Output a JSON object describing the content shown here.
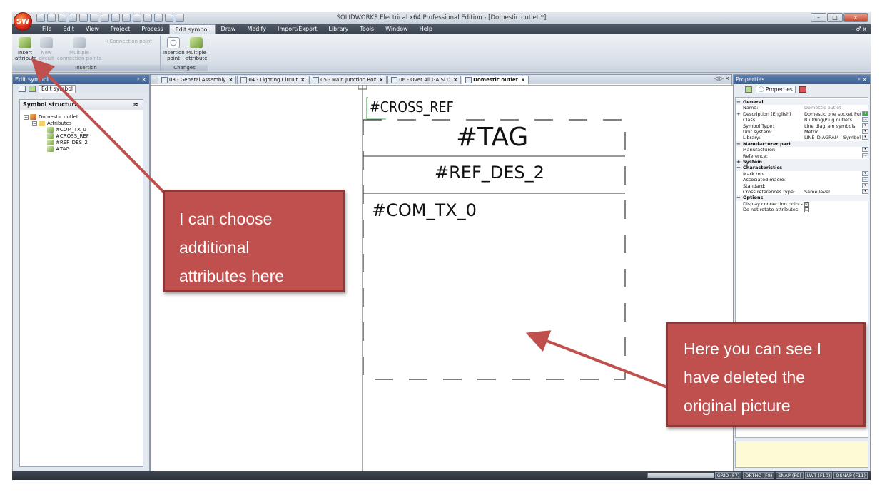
{
  "app": {
    "title": "SOLIDWORKS Electrical x64 Professional Edition - [Domestic outlet *]",
    "logo": "SW",
    "minimize": "–",
    "restore": "□",
    "close": "x"
  },
  "menu": {
    "items": [
      "File",
      "Edit",
      "View",
      "Project",
      "Process",
      "Edit symbol",
      "Draw",
      "Modify",
      "Import/Export",
      "Library",
      "Tools",
      "Window",
      "Help"
    ],
    "active_index": 5,
    "right_controls": "– ♂ x"
  },
  "ribbon": {
    "insertion_group": "Insertion",
    "changes_group": "Changes",
    "insert_attribute": "Insert\nattribute",
    "new_circuit": "New\ncircuit",
    "multiple_connection_points": "Multiple\nconnection points",
    "connection_point": "Connection point",
    "insertion_point": "Insertion\npoint",
    "multiple_attribute": "Multiple\nattribute"
  },
  "left_pane": {
    "title": "Edit symbol",
    "pin": "ᵖ ×",
    "tab": "Edit symbol",
    "panel_title": "Symbol structure",
    "collapse": "≈",
    "root": "Domestic outlet",
    "folder": "Attributes",
    "attributes": [
      "#COM_TX_0",
      "#CROSS_REF",
      "#REF_DES_2",
      "#TAG"
    ]
  },
  "doc_tabs": [
    {
      "label": "03 - General Assembly",
      "active": false
    },
    {
      "label": "04 - Lighting Circuit",
      "active": false
    },
    {
      "label": "05 - Main Junction Box",
      "active": false
    },
    {
      "label": "06 - Over All GA SLD",
      "active": false
    },
    {
      "label": "Domestic outlet",
      "active": true
    }
  ],
  "doc_tabs_nav": "◁ ▷ ×",
  "symbol": {
    "cross_ref": "#CROSS_REF",
    "tag": "#TAG",
    "ref_des": "#REF_DES_2",
    "com_tx": "#COM_TX_0"
  },
  "properties": {
    "title": "Properties",
    "pin": "ᵖ ×",
    "tab": "Properties",
    "rows": [
      {
        "kind": "cat",
        "label": "General",
        "exp": "−"
      },
      {
        "kind": "prop",
        "label": "Name:",
        "value": "Domestic outlet",
        "gray": true
      },
      {
        "kind": "prop",
        "label": "Description (English)",
        "value": "Domestic one socket Putlet",
        "exp": "+",
        "btn": "+"
      },
      {
        "kind": "prop",
        "label": "Class:",
        "value": "Building\\Plug outlets",
        "btn": "..."
      },
      {
        "kind": "prop",
        "label": "Symbol Type:",
        "value": "Line diagram symbols",
        "btn": "▾"
      },
      {
        "kind": "prop",
        "label": "Unit system:",
        "value": "Metric",
        "btn": "▾"
      },
      {
        "kind": "prop",
        "label": "Library:",
        "value": "LINE_DIAGRAM - Symbol f",
        "btn": "▾"
      },
      {
        "kind": "cat",
        "label": "Manufacturer part",
        "exp": "−"
      },
      {
        "kind": "prop",
        "label": "Manufacturer:",
        "value": "",
        "btn": "▾"
      },
      {
        "kind": "prop",
        "label": "Reference:",
        "value": "",
        "btn": "..."
      },
      {
        "kind": "cat",
        "label": "System",
        "exp": "+"
      },
      {
        "kind": "cat",
        "label": "Characteristics",
        "exp": "−"
      },
      {
        "kind": "prop",
        "label": "Mark root:",
        "value": "",
        "btn": "▾"
      },
      {
        "kind": "prop",
        "label": "Associated macro:",
        "value": "",
        "btn": "..."
      },
      {
        "kind": "prop",
        "label": "Standard:",
        "value": "",
        "btn": "▾"
      },
      {
        "kind": "prop",
        "label": "Cross references type:",
        "value": "Same level",
        "btn": "▾"
      },
      {
        "kind": "cat",
        "label": "Options",
        "exp": "−"
      },
      {
        "kind": "prop",
        "label": "Display connection points:",
        "value": "☑",
        "check": true
      },
      {
        "kind": "prop",
        "label": "Do not rotate attributes:",
        "value": "☐",
        "check": true
      }
    ]
  },
  "statusbar": [
    "GRID (F7)",
    "ORTHO (F8)",
    "SNAP (F9)",
    "LWT (F10)",
    "OSNAP (F11)"
  ],
  "callouts": {
    "attributes": [
      "I can choose",
      "additional",
      "attributes here"
    ],
    "deleted": [
      "Here you can see I",
      "have deleted the",
      "original picture"
    ]
  },
  "colors": {
    "callout": "#c0504d",
    "arrow": "#c0504d",
    "pane_title": "#3c5f93"
  }
}
